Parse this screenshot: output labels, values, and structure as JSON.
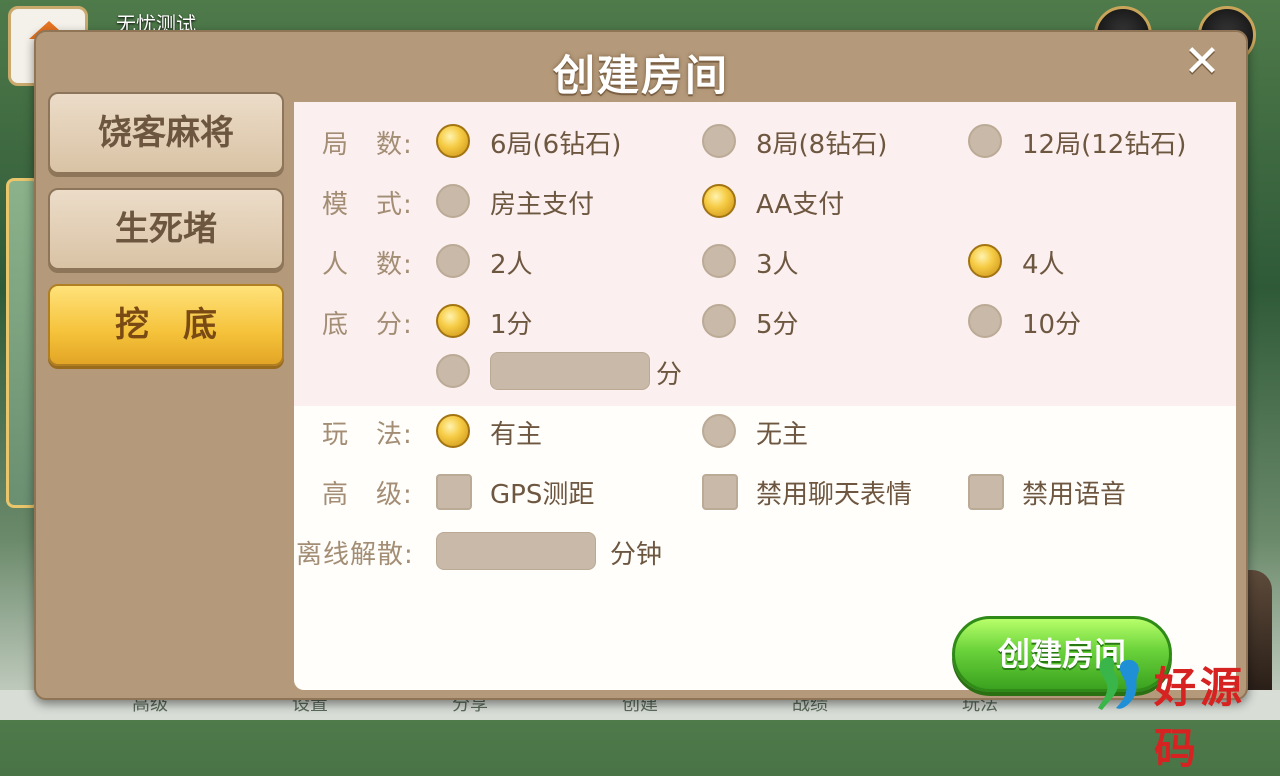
{
  "background": {
    "user_name": "无忧测试",
    "bottom_items": [
      "高级",
      "设置",
      "分享",
      "创建",
      "战绩",
      "玩法"
    ]
  },
  "dialog": {
    "title": "创建房间",
    "close_label": "✕"
  },
  "tabs": [
    {
      "label": "饶客麻将",
      "active": false
    },
    {
      "label": "生死堵",
      "active": false
    },
    {
      "label": "挖　底",
      "active": true
    }
  ],
  "form": {
    "rounds": {
      "label": "局　数:",
      "options": [
        "6局(6钻石)",
        "8局(8钻石)",
        "12局(12钻石)"
      ],
      "selected": 0
    },
    "mode": {
      "label": "模　式:",
      "options": [
        "房主支付",
        "AA支付"
      ],
      "selected": 1
    },
    "players": {
      "label": "人　数:",
      "options": [
        "2人",
        "3人",
        "4人"
      ],
      "selected": 2
    },
    "base_score": {
      "label": "底　分:",
      "options": [
        "1分",
        "5分",
        "10分"
      ],
      "selected": 0,
      "custom_unit": "分",
      "custom_value": ""
    },
    "play": {
      "label": "玩　法:",
      "options": [
        "有主",
        "无主"
      ],
      "selected": 0
    },
    "advanced": {
      "label": "高　级:",
      "options": [
        "GPS测距",
        "禁用聊天表情",
        "禁用语音"
      ],
      "checked": [
        false,
        false,
        false
      ]
    },
    "offline": {
      "label": "离线解散:",
      "unit": "分钟",
      "value": ""
    }
  },
  "create_button": "创建房间",
  "watermark": "好源码",
  "colors": {
    "dialog_bg": "#b49a7a",
    "active_tab": "#f5c23a",
    "create_button": "#4cbf2a",
    "label": "#a38d74",
    "option_text": "#6e5741"
  }
}
